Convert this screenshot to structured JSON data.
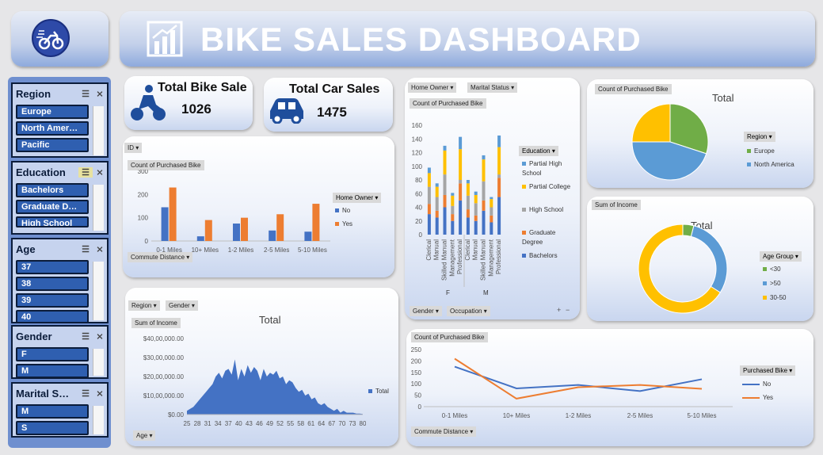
{
  "dashboard": {
    "title": "BIKE SALES DASHBOARD",
    "colors": {
      "blue": "#4472c4",
      "orange": "#ed7d31",
      "gray": "#a5a5a5",
      "yellow": "#ffc000",
      "green": "#70ad47",
      "lightblue": "#5b9bd5",
      "navy": "#0b1c3a"
    }
  },
  "kpis": {
    "bike_label": "Total Bike Sale",
    "bike_value": "1026",
    "car_label": "Total  Car Sales",
    "car_value": "1475"
  },
  "slicers": [
    {
      "title": "Region",
      "items": [
        "Europe",
        "North Amer…",
        "Pacific"
      ]
    },
    {
      "title": "Education",
      "items": [
        "Bachelors",
        "Graduate D…",
        "High School"
      ]
    },
    {
      "title": "Age",
      "items": [
        "37",
        "38",
        "39",
        "40"
      ]
    },
    {
      "title": "Gender",
      "items": [
        "F",
        "M"
      ]
    },
    {
      "title": "Marital S…",
      "items": [
        "M",
        "S"
      ]
    }
  ],
  "pivot_commute_bar": {
    "filter_chip": "ID",
    "value_chip": "Count of Purchased Bike",
    "axis_chip": "Commute Distance",
    "legend_title": "Home Owner"
  },
  "pivot_education": {
    "filter_chips": [
      "Home Owner",
      "Marital Status"
    ],
    "value_chip": "Count of Purchased Bike",
    "legend_title": "Education",
    "axis_chips": [
      "Gender",
      "Occupation"
    ],
    "gender_labels": [
      "F",
      "M"
    ],
    "expand_buttons": [
      "+",
      "−"
    ]
  },
  "pivot_region_pie": {
    "value_chip": "Count of Purchased Bike",
    "title": "Total",
    "legend_title": "Region"
  },
  "pivot_income_donut": {
    "value_chip": "Sum of Income",
    "title": "Total",
    "legend_title": "Age Group"
  },
  "pivot_income_area": {
    "filter_chips": [
      "Region",
      "Gender"
    ],
    "value_chip": "Sum of Income",
    "title": "Total",
    "axis_chip": "Age"
  },
  "pivot_commute_line": {
    "value_chip": "Count of Purchased Bike",
    "axis_chip": "Commute Distance",
    "legend_title": "Purchased  Bike"
  },
  "chart_data": [
    {
      "type": "bar",
      "categories": [
        "0-1 Miles",
        "10+ Miles",
        "1-2 Miles",
        "2-5 Miles",
        "5-10 Miles"
      ],
      "series": [
        {
          "name": "No",
          "values": [
            145,
            20,
            75,
            45,
            40
          ],
          "color": "#4472c4"
        },
        {
          "name": "Yes",
          "values": [
            230,
            90,
            100,
            115,
            160
          ],
          "color": "#ed7d31"
        }
      ],
      "ylim": [
        0,
        300
      ],
      "yticks": [
        0,
        100,
        200,
        300
      ]
    },
    {
      "type": "bar",
      "stacked": true,
      "categories": [
        "Clerical",
        "Manual",
        "Skilled Manual",
        "Management",
        "Professional",
        "Clerical",
        "Manual",
        "Skilled Manual",
        "Management",
        "Professional"
      ],
      "series": [
        {
          "name": "Bachelors",
          "values": [
            30,
            25,
            40,
            20,
            50,
            25,
            20,
            35,
            18,
            55
          ],
          "color": "#4472c4"
        },
        {
          "name": "Graduate Degree",
          "values": [
            15,
            10,
            18,
            10,
            25,
            12,
            8,
            15,
            10,
            28
          ],
          "color": "#ed7d31"
        },
        {
          "name": "High School",
          "values": [
            25,
            20,
            30,
            12,
            5,
            20,
            18,
            28,
            12,
            5
          ],
          "color": "#a5a5a5"
        },
        {
          "name": "Partial College",
          "values": [
            20,
            15,
            35,
            15,
            45,
            18,
            12,
            32,
            12,
            40
          ],
          "color": "#ffc000"
        },
        {
          "name": "Partial High School",
          "values": [
            8,
            5,
            7,
            4,
            18,
            5,
            5,
            6,
            3,
            17
          ],
          "color": "#5b9bd5"
        }
      ],
      "ylim": [
        0,
        160
      ],
      "yticks": [
        0,
        20,
        40,
        60,
        80,
        100,
        120,
        140,
        160
      ]
    },
    {
      "type": "pie",
      "categories": [
        "Europe",
        "North America",
        "Pacific"
      ],
      "values": [
        30,
        45,
        25
      ],
      "colors": [
        "#70ad47",
        "#5b9bd5",
        "#ffc000"
      ]
    },
    {
      "type": "pie",
      "donut": true,
      "categories": [
        "<30",
        ">50",
        "30-50"
      ],
      "values": [
        4,
        30,
        66
      ],
      "colors": [
        "#70ad47",
        "#5b9bd5",
        "#ffc000"
      ]
    },
    {
      "type": "area",
      "series_name": "Total",
      "x_labels": [
        "25",
        "28",
        "31",
        "34",
        "37",
        "40",
        "43",
        "46",
        "49",
        "52",
        "55",
        "58",
        "61",
        "64",
        "67",
        "70",
        "73",
        "80"
      ],
      "ages": [
        25,
        26,
        27,
        28,
        29,
        30,
        31,
        32,
        33,
        34,
        35,
        36,
        37,
        38,
        39,
        40,
        41,
        42,
        43,
        44,
        45,
        46,
        47,
        48,
        49,
        50,
        51,
        52,
        53,
        54,
        55,
        56,
        57,
        58,
        59,
        60,
        61,
        62,
        63,
        64,
        65,
        66,
        67,
        68,
        69,
        70,
        71,
        72,
        73,
        74,
        75,
        76,
        77,
        78,
        79,
        80
      ],
      "values": [
        2,
        3,
        4,
        6,
        8,
        10,
        12,
        14,
        16,
        20,
        22,
        19,
        23,
        24,
        21,
        29,
        18,
        24,
        20,
        26,
        22,
        25,
        23,
        18,
        24,
        20,
        22,
        21,
        23,
        19,
        20,
        16,
        18,
        17,
        14,
        12,
        13,
        10,
        11,
        8,
        9,
        6,
        5,
        6,
        4,
        3,
        2,
        3,
        1,
        2,
        1,
        1,
        1,
        0.5,
        0.5,
        0.3
      ],
      "yticks": [
        "$0.00",
        "$10,00,000.00",
        "$20,00,000.00",
        "$30,00,000.00",
        "$40,00,000.00"
      ],
      "ymax": 40,
      "color": "#4472c4"
    },
    {
      "type": "line",
      "categories": [
        "0-1 Miles",
        "10+ Miles",
        "1-2 Miles",
        "2-5 Miles",
        "5-10 Miles"
      ],
      "series": [
        {
          "name": "No",
          "values": [
            175,
            80,
            95,
            68,
            120
          ],
          "color": "#4472c4"
        },
        {
          "name": "Yes",
          "values": [
            210,
            35,
            85,
            95,
            78
          ],
          "color": "#ed7d31"
        }
      ],
      "ylim": [
        0,
        250
      ],
      "yticks": [
        0,
        50,
        100,
        150,
        200,
        250
      ]
    }
  ]
}
